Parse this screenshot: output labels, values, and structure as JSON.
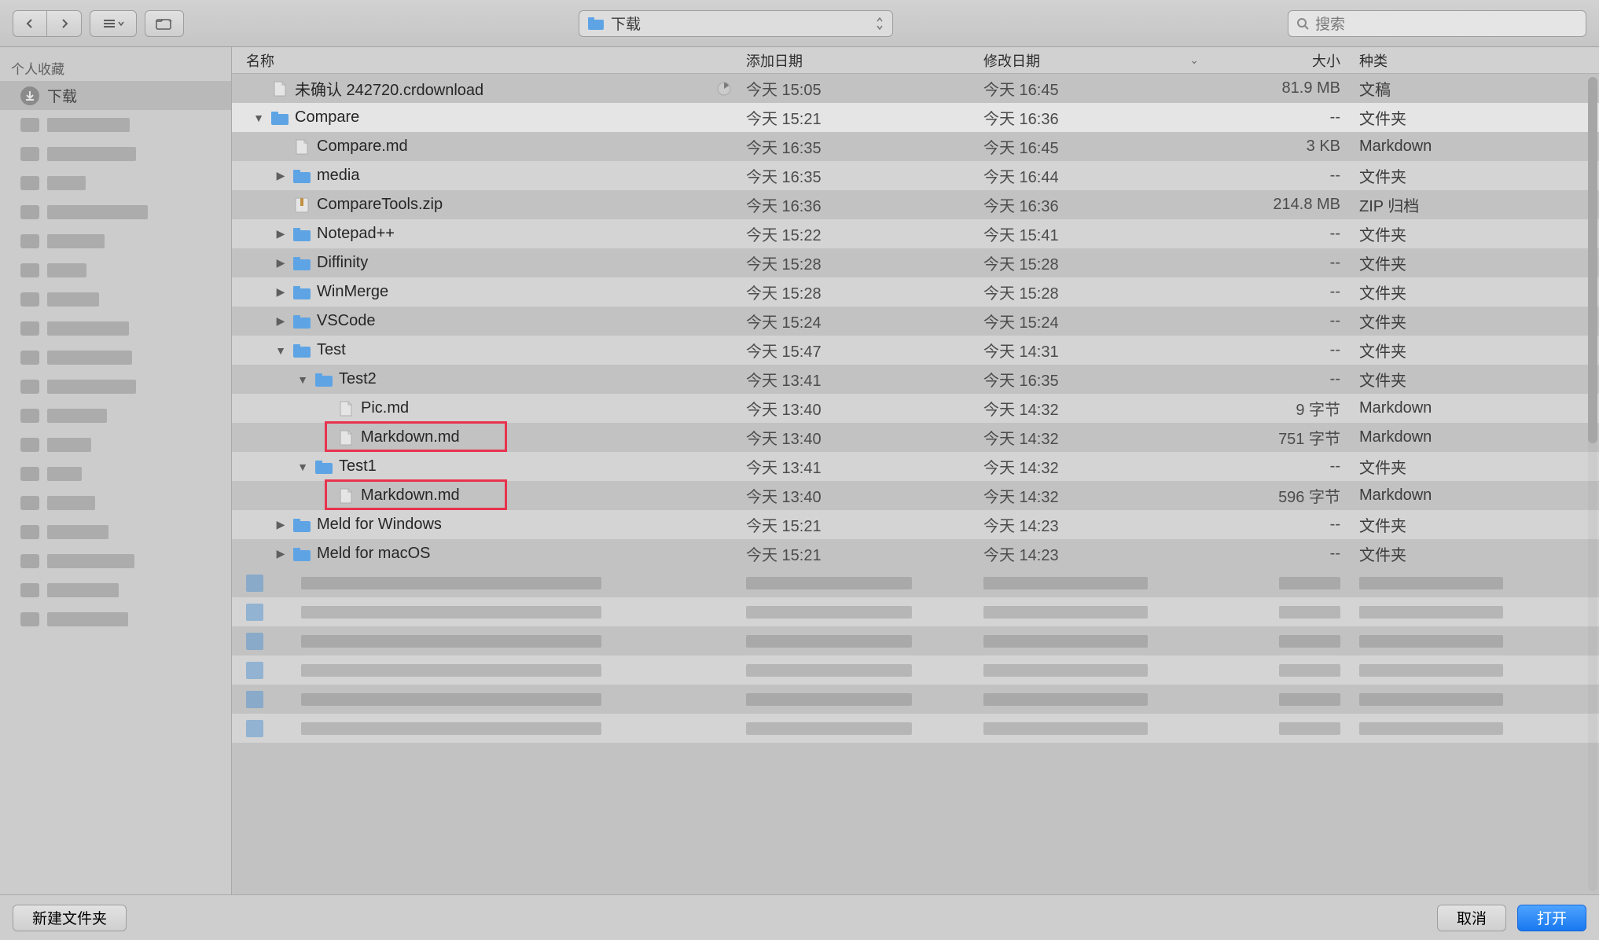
{
  "toolbar": {
    "path_label": "下载",
    "search_placeholder": "搜索"
  },
  "sidebar": {
    "section_label": "个人收藏",
    "downloads_label": "下载"
  },
  "columns": {
    "name": "名称",
    "date_added": "添加日期",
    "date_modified": "修改日期",
    "size": "大小",
    "kind": "种类"
  },
  "rows": [
    {
      "indent": 0,
      "disclosure": "",
      "icon": "file",
      "name": "未确认 242720.crdownload",
      "progress": true,
      "added": "今天 15:05",
      "modified": "今天 16:45",
      "size": "81.9 MB",
      "kind": "文稿",
      "zebra": false,
      "selected": false
    },
    {
      "indent": 0,
      "disclosure": "▼",
      "icon": "folder",
      "name": "Compare",
      "added": "今天 15:21",
      "modified": "今天 16:36",
      "size": "--",
      "kind": "文件夹",
      "zebra": true,
      "selected": true
    },
    {
      "indent": 1,
      "disclosure": "",
      "icon": "file",
      "name": "Compare.md",
      "added": "今天 16:35",
      "modified": "今天 16:45",
      "size": "3 KB",
      "kind": "Markdown",
      "zebra": false
    },
    {
      "indent": 1,
      "disclosure": "▶",
      "icon": "folder",
      "name": "media",
      "added": "今天 16:35",
      "modified": "今天 16:44",
      "size": "--",
      "kind": "文件夹",
      "zebra": true
    },
    {
      "indent": 1,
      "disclosure": "",
      "icon": "zip",
      "name": "CompareTools.zip",
      "added": "今天 16:36",
      "modified": "今天 16:36",
      "size": "214.8 MB",
      "kind": "ZIP 归档",
      "zebra": false
    },
    {
      "indent": 1,
      "disclosure": "▶",
      "icon": "folder",
      "name": "Notepad++",
      "added": "今天 15:22",
      "modified": "今天 15:41",
      "size": "--",
      "kind": "文件夹",
      "zebra": true
    },
    {
      "indent": 1,
      "disclosure": "▶",
      "icon": "folder",
      "name": "Diffinity",
      "added": "今天 15:28",
      "modified": "今天 15:28",
      "size": "--",
      "kind": "文件夹",
      "zebra": false
    },
    {
      "indent": 1,
      "disclosure": "▶",
      "icon": "folder",
      "name": "WinMerge",
      "added": "今天 15:28",
      "modified": "今天 15:28",
      "size": "--",
      "kind": "文件夹",
      "zebra": true
    },
    {
      "indent": 1,
      "disclosure": "▶",
      "icon": "folder",
      "name": "VSCode",
      "added": "今天 15:24",
      "modified": "今天 15:24",
      "size": "--",
      "kind": "文件夹",
      "zebra": false
    },
    {
      "indent": 1,
      "disclosure": "▼",
      "icon": "folder",
      "name": "Test",
      "added": "今天 15:47",
      "modified": "今天 14:31",
      "size": "--",
      "kind": "文件夹",
      "zebra": true
    },
    {
      "indent": 2,
      "disclosure": "▼",
      "icon": "folder",
      "name": "Test2",
      "added": "今天 13:41",
      "modified": "今天 16:35",
      "size": "--",
      "kind": "文件夹",
      "zebra": false
    },
    {
      "indent": 3,
      "disclosure": "",
      "icon": "file",
      "name": "Pic.md",
      "added": "今天 13:40",
      "modified": "今天 14:32",
      "size": "9 字节",
      "kind": "Markdown",
      "zebra": true
    },
    {
      "indent": 3,
      "disclosure": "",
      "icon": "file",
      "name": "Markdown.md",
      "added": "今天 13:40",
      "modified": "今天 14:32",
      "size": "751 字节",
      "kind": "Markdown",
      "zebra": false,
      "highlight": true
    },
    {
      "indent": 2,
      "disclosure": "▼",
      "icon": "folder",
      "name": "Test1",
      "added": "今天 13:41",
      "modified": "今天 14:32",
      "size": "--",
      "kind": "文件夹",
      "zebra": true
    },
    {
      "indent": 3,
      "disclosure": "",
      "icon": "file",
      "name": "Markdown.md",
      "added": "今天 13:40",
      "modified": "今天 14:32",
      "size": "596 字节",
      "kind": "Markdown",
      "zebra": false,
      "highlight": true
    },
    {
      "indent": 1,
      "disclosure": "▶",
      "icon": "folder",
      "name": "Meld for Windows",
      "added": "今天 15:21",
      "modified": "今天 14:23",
      "size": "--",
      "kind": "文件夹",
      "zebra": true
    },
    {
      "indent": 1,
      "disclosure": "▶",
      "icon": "folder",
      "name": "Meld for macOS",
      "added": "今天 15:21",
      "modified": "今天 14:23",
      "size": "--",
      "kind": "文件夹",
      "zebra": false
    }
  ],
  "blur_rows": 6,
  "footer": {
    "new_folder": "新建文件夹",
    "cancel": "取消",
    "open": "打开"
  }
}
